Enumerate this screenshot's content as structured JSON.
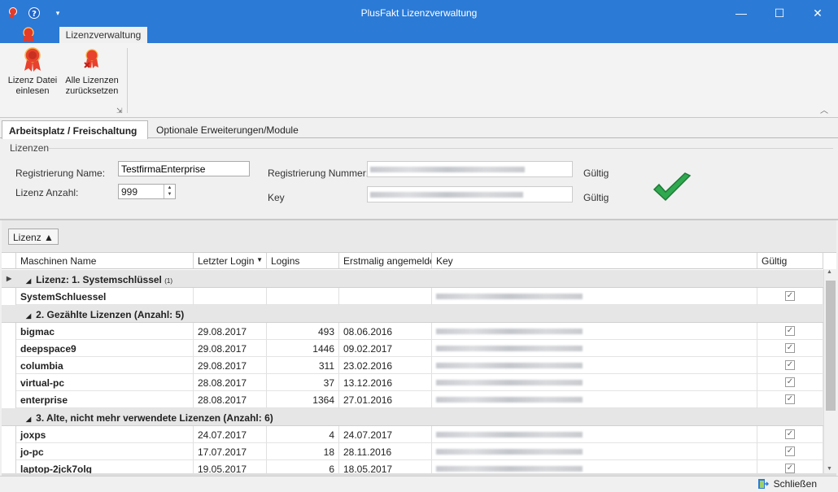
{
  "window": {
    "title": "PlusFakt Lizenzverwaltung",
    "min": "—",
    "max": "☐",
    "close": "✕"
  },
  "ribbon": {
    "tab": "Lizenzverwaltung",
    "btn_read": [
      "Lizenz Datei",
      "einlesen"
    ],
    "btn_reset": [
      "Alle Lizenzen",
      "zurücksetzen"
    ]
  },
  "tabs": {
    "active": "Arbeitsplatz / Freischaltung",
    "other": "Optionale Erweiterungen/Module"
  },
  "form": {
    "group": "Lizenzen",
    "reg_name_label": "Registrierung Name:",
    "reg_name": "TestfirmaEnterprise",
    "count_label": "Lizenz Anzahl:",
    "count": "999",
    "reg_nr_label": "Registrierung Nummer:",
    "key_label": "Key",
    "status1": "Gültig",
    "status2": "Gültig"
  },
  "grid": {
    "group_chip": "Lizenz ▲",
    "columns": [
      "Maschinen Name",
      "Letzter Login",
      "Logins",
      "Erstmalig angemeldet",
      "Key",
      "Gültig"
    ],
    "groups": [
      {
        "title": "Lizenz: 1. Systemschlüssel",
        "count": "(1)",
        "rows": [
          {
            "name": "SystemSchluessel",
            "login": "",
            "logins": "",
            "first": ""
          }
        ]
      },
      {
        "title": "2. Gezählte Lizenzen (Anzahl: 5)",
        "rows": [
          {
            "name": "bigmac",
            "login": "29.08.2017",
            "logins": "493",
            "first": "08.06.2016"
          },
          {
            "name": "deepspace9",
            "login": "29.08.2017",
            "logins": "1446",
            "first": "09.02.2017"
          },
          {
            "name": "columbia",
            "login": "29.08.2017",
            "logins": "311",
            "first": "23.02.2016"
          },
          {
            "name": "virtual-pc",
            "login": "28.08.2017",
            "logins": "37",
            "first": "13.12.2016"
          },
          {
            "name": "enterprise",
            "login": "28.08.2017",
            "logins": "1364",
            "first": "27.01.2016"
          }
        ]
      },
      {
        "title": "3. Alte, nicht mehr verwendete Lizenzen (Anzahl: 6)",
        "rows": [
          {
            "name": "joxps",
            "login": "24.07.2017",
            "logins": "4",
            "first": "24.07.2017"
          },
          {
            "name": "jo-pc",
            "login": "17.07.2017",
            "logins": "18",
            "first": "28.11.2016"
          },
          {
            "name": "laptop-2jck7olg",
            "login": "19.05.2017",
            "logins": "6",
            "first": "18.05.2017"
          }
        ]
      }
    ]
  },
  "status": {
    "close_label": "Schließen"
  }
}
